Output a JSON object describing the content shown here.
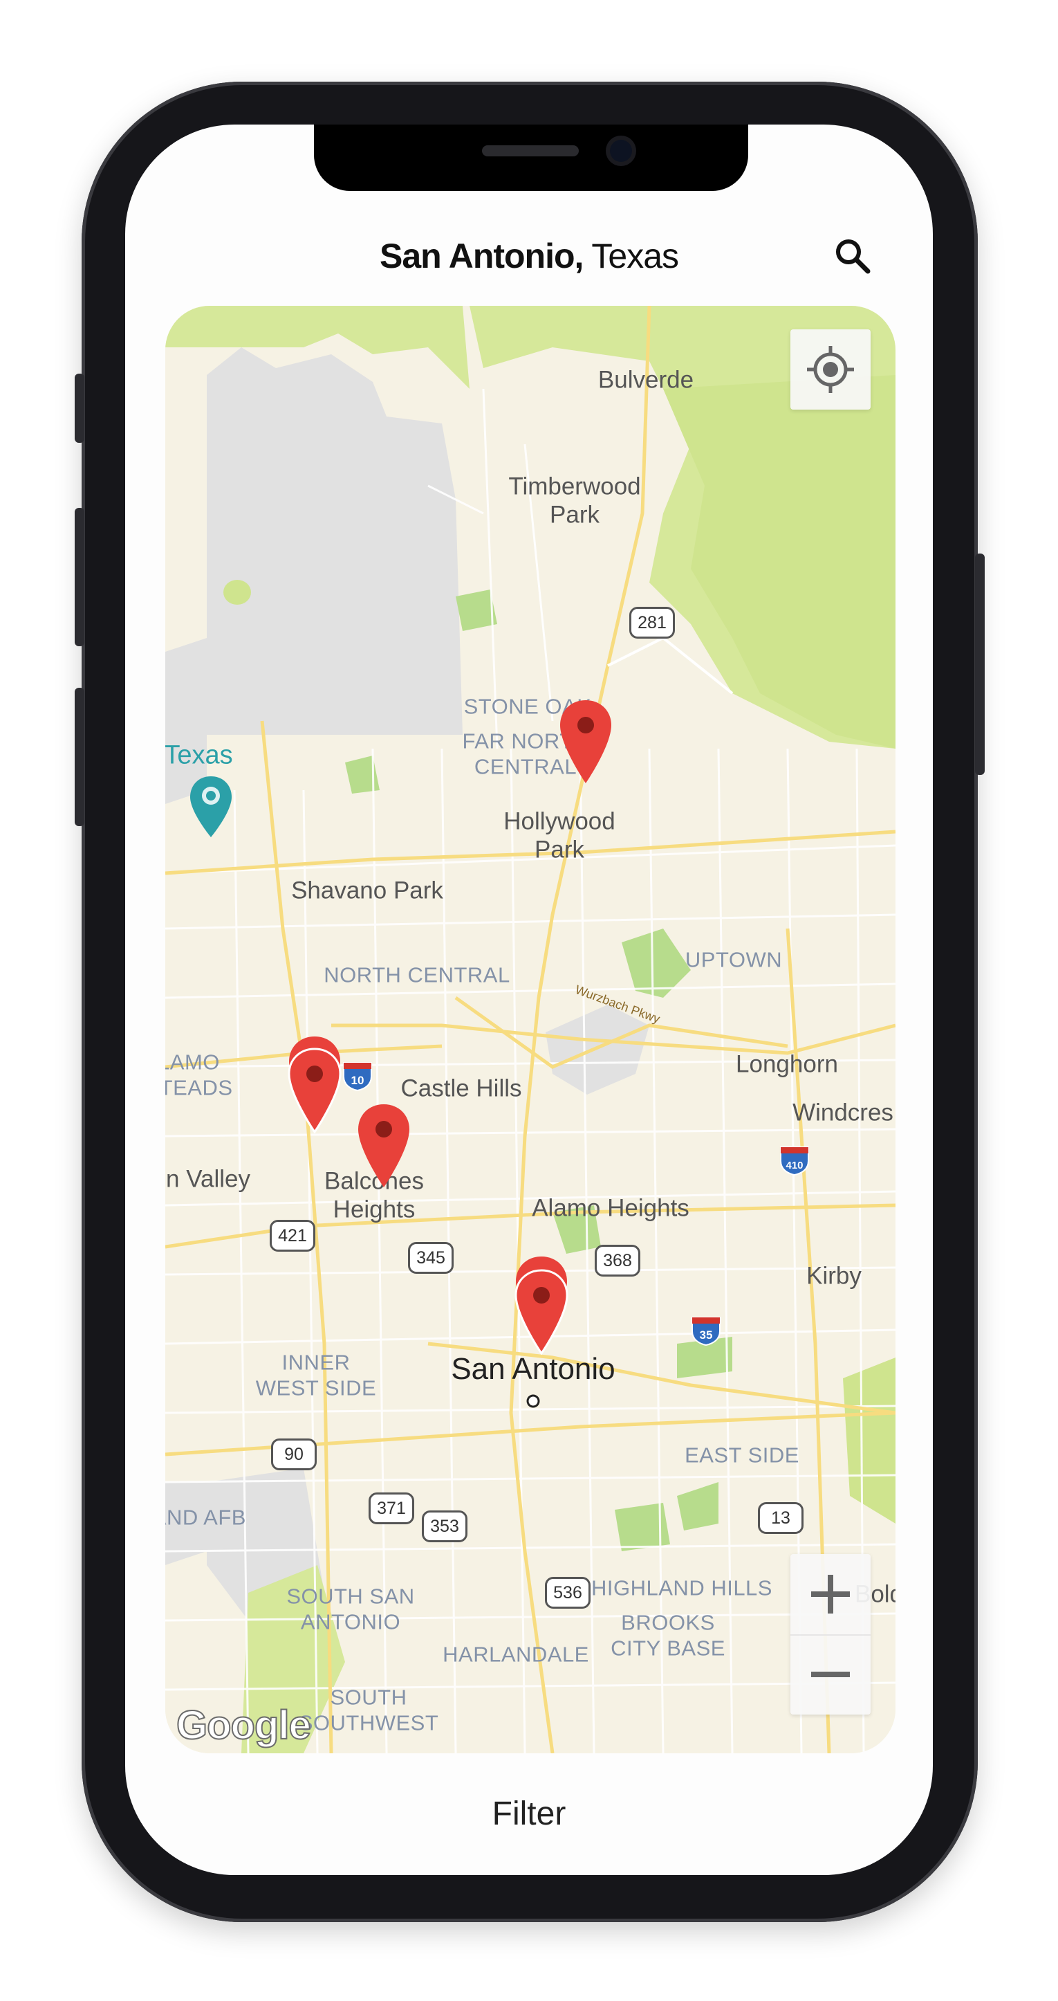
{
  "header": {
    "city": "San Antonio,",
    "state": " Texas"
  },
  "icons": {
    "search": "search-icon",
    "locate": "crosshair-icon",
    "zoom_in": "plus-icon",
    "zoom_out": "minus-icon",
    "pin": "map-pin-icon"
  },
  "colors": {
    "pin": "#e8413a",
    "pin_dot": "#8b1d18",
    "park_green": "#d6e89a",
    "map_bg": "#f6f2e4",
    "road": "#f7dc80",
    "water_teal": "#2ba0a8"
  },
  "map": {
    "labels": {
      "bulverde": "Bulverde",
      "timberwood": "Timberwood\nPark",
      "stone_oak": "STONE OAK",
      "far_north": "FAR NORTH\nCENTRAL",
      "hollywood": "Hollywood\nPark",
      "texas_park": "Texas",
      "shavano": "Shavano Park",
      "north_central": "NORTH CENTRAL",
      "uptown": "UPTOWN",
      "wurzbach": "Wurzbach Pkwy",
      "alamo_steads": "LAMO\nSTEADS",
      "castle_hills": "Castle Hills",
      "longhorn": "Longhorn",
      "windcrest": "Windcres",
      "leon_valley": "n Valley",
      "balcones": "Balcones\nHeights",
      "alamo_heights": "Alamo Heights",
      "kirby": "Kirby",
      "inner_west": "INNER\nWEST SIDE",
      "san_antonio": "San Antonio",
      "east_side": "EAST SIDE",
      "lackland": "LAND AFB",
      "south_san": "SOUTH SAN\nANTONIO",
      "highland": "HIGHLAND HILLS",
      "brooks": "BROOKS\nCITY BASE",
      "harlandale": "HARLANDALE",
      "south_sw": "SOUTH\nSOUTHWEST",
      "bold": "Bold"
    },
    "shields": {
      "us281": "281",
      "i10": "10",
      "i410": "410",
      "tx421": "421",
      "tx345": "345",
      "tx368": "368",
      "i35": "35",
      "us90": "90",
      "tx371": "371",
      "tx353": "353",
      "tx13": "13",
      "tx536": "536"
    },
    "attribution": "Google"
  },
  "footer": {
    "filter_label": "Filter"
  }
}
